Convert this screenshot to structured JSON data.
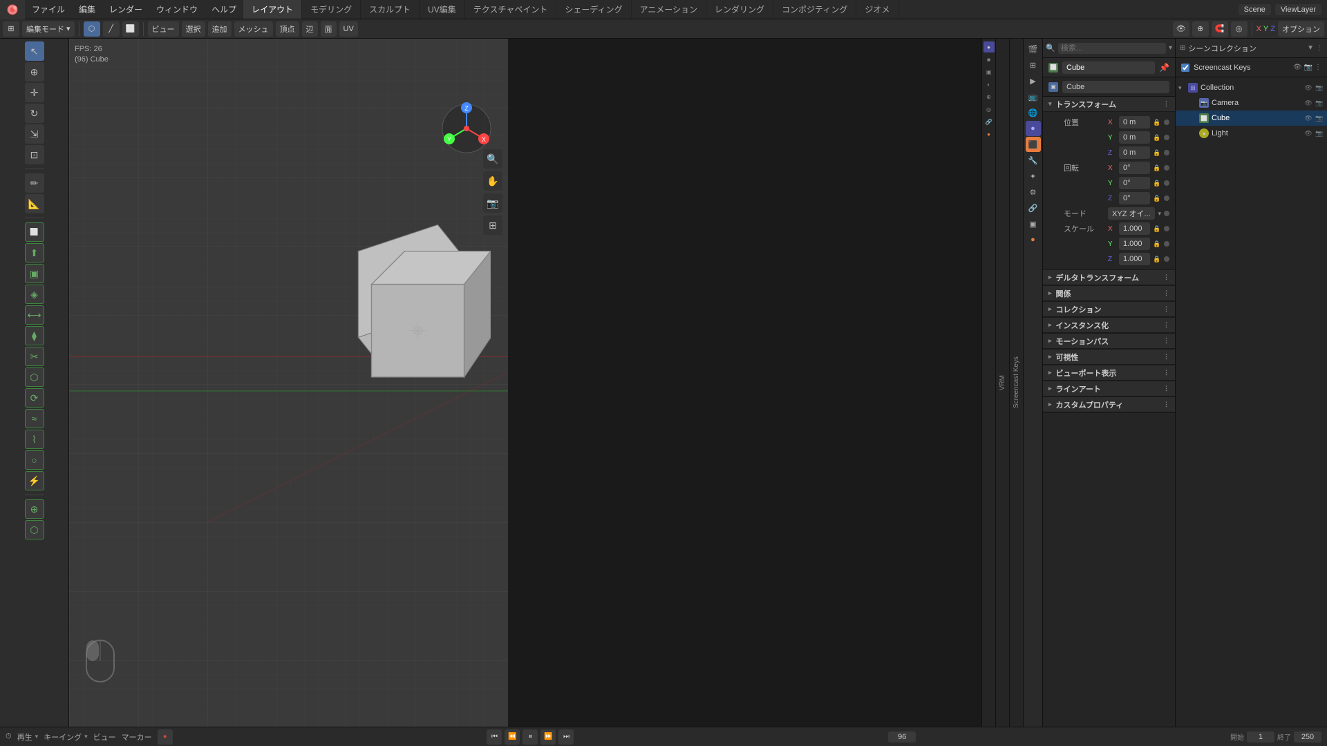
{
  "app": {
    "title": "Blender",
    "logo": "●"
  },
  "top_menu": {
    "items": [
      "ファイル",
      "編集",
      "レンダー",
      "ウィンドウ",
      "ヘルプ"
    ]
  },
  "workspace_tabs": {
    "items": [
      "レイアウト",
      "モデリング",
      "スカルプト",
      "UV編集",
      "テクスチャペイント",
      "シェーディング",
      "アニメーション",
      "レンダリング",
      "コンポジティング",
      "ジオメ"
    ],
    "active": "レイアウト"
  },
  "top_right": {
    "scene": "Scene",
    "view_layer": "ViewLayer"
  },
  "viewport": {
    "fps": "FPS: 26",
    "object": "(96) Cube",
    "mode": "編集モード",
    "axes": [
      "X",
      "Y",
      "Z"
    ],
    "options": "オプション"
  },
  "toolbar": {
    "mode_label": "編集モード",
    "view": "ビュー",
    "select": "選択",
    "add": "追加",
    "mesh": "メッシュ",
    "vertex": "頂点",
    "edge": "辺",
    "face": "面",
    "uv": "UV"
  },
  "scene_collection": {
    "title": "シーンコレクション",
    "items": [
      {
        "type": "collection",
        "label": "Collection",
        "expanded": true,
        "indent": 0
      },
      {
        "type": "camera",
        "label": "Camera",
        "indent": 1
      },
      {
        "type": "cube",
        "label": "Cube",
        "indent": 1,
        "selected": true
      },
      {
        "type": "light",
        "label": "Light",
        "indent": 1
      }
    ]
  },
  "screencast_keys": {
    "label": "Screencast Keys",
    "checked": true
  },
  "properties": {
    "object_name": "Cube",
    "data_name": "Cube",
    "transform_section": "トランスフォーム",
    "location": {
      "label": "位置",
      "x": "0 m",
      "y": "0 m",
      "z": "0 m"
    },
    "rotation": {
      "label": "回転",
      "x": "0°",
      "y": "0°",
      "z": "0°",
      "mode_label": "モード",
      "mode_value": "XYZ オイ..."
    },
    "scale": {
      "label": "スケール",
      "x": "1.000",
      "y": "1.000",
      "z": "1.000"
    },
    "sections": [
      "デルタトランスフォーム",
      "関係",
      "コレクション",
      "インスタンス化",
      "モーションパス",
      "可視性",
      "ビューポート表示",
      "ラインアート",
      "カスタムプロパティ"
    ]
  },
  "timeline": {
    "play_label": "再生",
    "keying_label": "キーイング",
    "view_label": "ビュー",
    "marker_label": "マーカー",
    "frame_current": "96",
    "frame_start_label": "開始",
    "frame_start": "1",
    "frame_end_label": "終了",
    "frame_end": "250"
  },
  "vrm_label": "Screencast Keys",
  "nav_widget": {
    "x_color": "#e44",
    "y_color": "#4e4",
    "z_color": "#44e"
  }
}
